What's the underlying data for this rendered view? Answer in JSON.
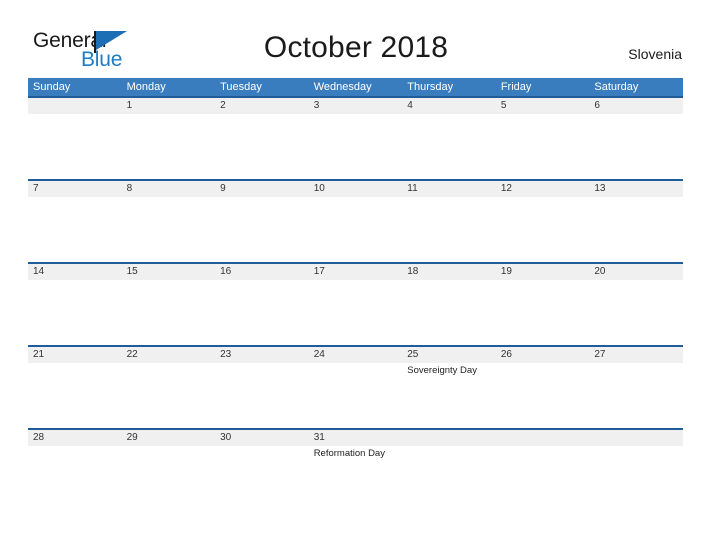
{
  "logo": {
    "word_one": "General",
    "word_two": "Blue",
    "flag_icon": "flag-triangle-icon"
  },
  "header": {
    "title": "October 2018",
    "country": "Slovenia"
  },
  "calendar": {
    "day_headers": [
      "Sunday",
      "Monday",
      "Tuesday",
      "Wednesday",
      "Thursday",
      "Friday",
      "Saturday"
    ],
    "colors": {
      "header_blue": "#3a7dbf",
      "band_rule": "#1f5c99",
      "band_fill": "#f0f0f0",
      "logo_blue": "#1d7cc4",
      "text": "#1a1a1a"
    },
    "weeks": [
      {
        "days": [
          {
            "date": "",
            "event": ""
          },
          {
            "date": "1",
            "event": ""
          },
          {
            "date": "2",
            "event": ""
          },
          {
            "date": "3",
            "event": ""
          },
          {
            "date": "4",
            "event": ""
          },
          {
            "date": "5",
            "event": ""
          },
          {
            "date": "6",
            "event": ""
          }
        ]
      },
      {
        "days": [
          {
            "date": "7",
            "event": ""
          },
          {
            "date": "8",
            "event": ""
          },
          {
            "date": "9",
            "event": ""
          },
          {
            "date": "10",
            "event": ""
          },
          {
            "date": "11",
            "event": ""
          },
          {
            "date": "12",
            "event": ""
          },
          {
            "date": "13",
            "event": ""
          }
        ]
      },
      {
        "days": [
          {
            "date": "14",
            "event": ""
          },
          {
            "date": "15",
            "event": ""
          },
          {
            "date": "16",
            "event": ""
          },
          {
            "date": "17",
            "event": ""
          },
          {
            "date": "18",
            "event": ""
          },
          {
            "date": "19",
            "event": ""
          },
          {
            "date": "20",
            "event": ""
          }
        ]
      },
      {
        "days": [
          {
            "date": "21",
            "event": ""
          },
          {
            "date": "22",
            "event": ""
          },
          {
            "date": "23",
            "event": ""
          },
          {
            "date": "24",
            "event": ""
          },
          {
            "date": "25",
            "event": "Sovereignty Day"
          },
          {
            "date": "26",
            "event": ""
          },
          {
            "date": "27",
            "event": ""
          }
        ]
      },
      {
        "days": [
          {
            "date": "28",
            "event": ""
          },
          {
            "date": "29",
            "event": ""
          },
          {
            "date": "30",
            "event": ""
          },
          {
            "date": "31",
            "event": "Reformation Day"
          },
          {
            "date": "",
            "event": ""
          },
          {
            "date": "",
            "event": ""
          },
          {
            "date": "",
            "event": ""
          }
        ]
      }
    ]
  }
}
